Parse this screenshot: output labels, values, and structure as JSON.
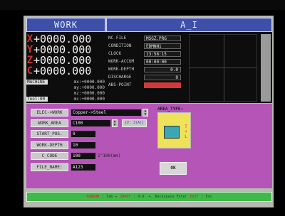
{
  "header": {
    "work_title": "WORK",
    "a_title": "A_I"
  },
  "coords": [
    {
      "axis": "X",
      "value": "+0000.000"
    },
    {
      "axis": "Y",
      "value": "+0000.000"
    },
    {
      "axis": "Z",
      "value": "+0000.000"
    },
    {
      "axis": "C",
      "value": "+0000.000"
    }
  ],
  "machine": [
    {
      "label": "MACHINE",
      "value": "mx:+0000.000"
    },
    {
      "label": "",
      "value": "my:+0000.000"
    },
    {
      "label": "",
      "value": "mz:+0000.000"
    },
    {
      "label": "Tool:00",
      "value": "mc:+0000.000"
    }
  ],
  "status": [
    {
      "label": "NC FILE",
      "value": "MSGZ.PRG"
    },
    {
      "label": "CONDITION",
      "value": "EDMNN1"
    },
    {
      "label": "CLOCK",
      "value": "13:58:15"
    },
    {
      "label": "WORK-ACCUM",
      "value": "00:00:00"
    },
    {
      "label": "WORK-DEPTH",
      "value": "0.0"
    },
    {
      "label": "DISCHARGE",
      "value": "0"
    },
    {
      "label": "ABS-POINT",
      "value": ""
    }
  ],
  "form": {
    "elec_work": {
      "label": "ELEC->WORK",
      "value": "Copper->Steel"
    },
    "work_area": {
      "label": "WORK_AREA",
      "value": "C100",
      "extra": "[V: 3(A)]"
    },
    "start_pos": {
      "label": "START_POS.",
      "value": "0"
    },
    "work_depth": {
      "label": "WORK-DEPTH",
      "value": "10"
    },
    "c_code": {
      "label": "C_CODE",
      "value": "100",
      "unit": "1\"100(mm)"
    },
    "file_name": {
      "label": "FILE_NAME:",
      "value": "A123"
    }
  },
  "area_type": {
    "title": "AREA_TYPE:",
    "letters": [
      "T",
      "+",
      "L"
    ]
  },
  "ok_label": "OK",
  "footer": {
    "k1": "CURSOR",
    "t1": ": Tab ↔",
    "k2": "INPUT",
    "t2": ": 0-9 -+. Backspace Enter",
    "k3": "EXIT",
    "t3": ": Esc"
  }
}
